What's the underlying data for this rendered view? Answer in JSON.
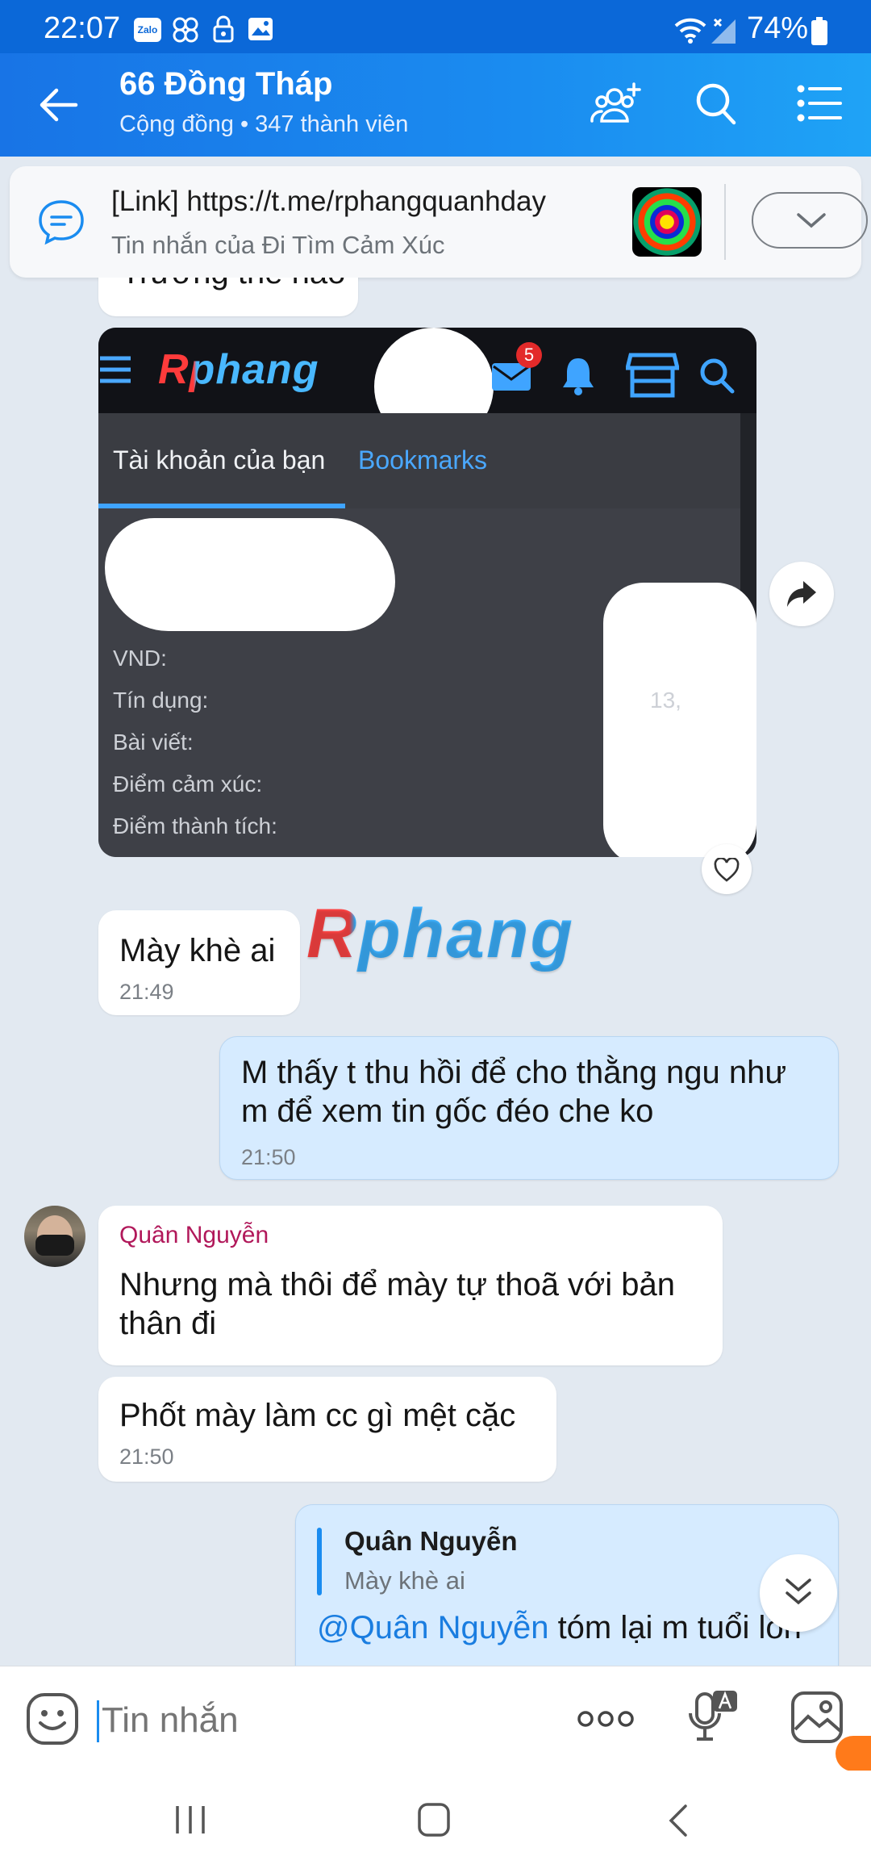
{
  "status": {
    "time": "22:07",
    "zalo_badge": "Zalo",
    "battery": "74%"
  },
  "header": {
    "title": "66 Đồng Tháp",
    "subtitle": "Cộng đồng • 347 thành viên"
  },
  "pinned": {
    "link": "[Link] https://t.me/rphangquanhday",
    "sub": "Tin nhắn của Đi Tìm Cảm Xúc"
  },
  "chat": {
    "partial_text": "Trường thế nào",
    "shot": {
      "logo": "Rphang",
      "mail_badge": "5",
      "tab_active": "Tài khoản của bạn",
      "tab_other": "Bookmarks",
      "rows": [
        "VND:",
        "Tín dụng:",
        "Bài viết:",
        "Điểm cảm xúc:",
        "Điểm thành tích:"
      ],
      "credit_value": "13,"
    },
    "sticker_text": "Rphang",
    "messages": [
      {
        "text": "Mày khè ai",
        "time": "21:49"
      },
      {
        "text": "M thấy t thu hồi để cho thằng ngu như m để xem tin gốc đéo che ko",
        "time": "21:50"
      },
      {
        "sender": "Quân Nguyễn",
        "text": "Nhưng mà thôi để mày tự thoã với bản thân đi"
      },
      {
        "text": "Phốt mày làm cc gì mệt cặc",
        "time": "21:50"
      },
      {
        "quote_name": "Quân Nguyễn",
        "quote_text": "Mày khè ai",
        "mention": "@Quân Nguyễn",
        "text": " tóm lại m tuổi lồn"
      }
    ]
  },
  "input": {
    "placeholder": "Tin nhắn"
  },
  "colors": {
    "header": "#1a8cf0",
    "mine_bubble": "#d6ebff",
    "sender_name": "#b1185a",
    "mention": "#1a7de0"
  }
}
